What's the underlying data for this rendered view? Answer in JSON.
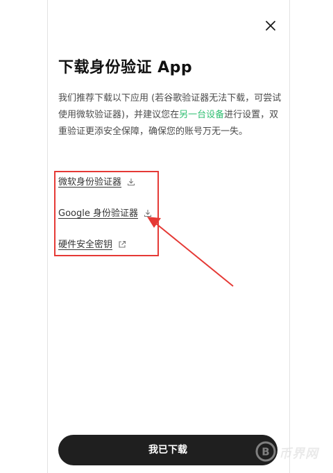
{
  "title": "下载身份验证 App",
  "description": {
    "text_before": "我们推荐下载以下应用 (若谷歌验证器无法下载，可尝试使用微软验证器)，并建议您在",
    "link": "另一台设备",
    "text_after": "进行设置，双重验证更添安全保障，确保您的账号万无一失。"
  },
  "links": [
    {
      "label": "微软身份验证器",
      "icon": "download-icon"
    },
    {
      "label": "Google 身份验证器",
      "icon": "download-icon"
    },
    {
      "label": "硬件安全密钥",
      "icon": "external-link-icon"
    }
  ],
  "primary_button": {
    "label": "我已下载"
  },
  "watermark": {
    "text": "币界网",
    "icon": "bitcoin-logo-icon"
  },
  "colors": {
    "accent_link": "#2fbf71",
    "annotation_red": "#e53935",
    "button_bg": "#1f1f1f"
  }
}
